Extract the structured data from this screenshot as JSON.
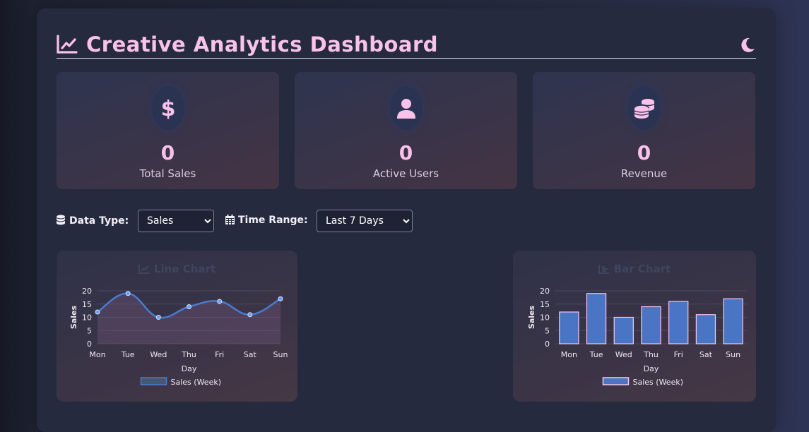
{
  "header": {
    "title": "Creative Analytics Dashboard",
    "title_icon": "chart-line-icon",
    "theme_toggle_icon": "moon-icon"
  },
  "stats": [
    {
      "icon": "dollar-icon",
      "value": "0",
      "label": "Total Sales"
    },
    {
      "icon": "user-icon",
      "value": "0",
      "label": "Active Users"
    },
    {
      "icon": "coins-icon",
      "value": "0",
      "label": "Revenue"
    }
  ],
  "controls": {
    "data_type_label": "Data Type:",
    "data_type_value": "Sales",
    "time_range_label": "Time Range:",
    "time_range_value": "Last 7 Days"
  },
  "colors": {
    "accent": "#f8c2ea",
    "series": "#4a7bd0",
    "panel": "#252a3f"
  },
  "chart_data": [
    {
      "type": "line",
      "title": "Line Chart",
      "categories": [
        "Mon",
        "Tue",
        "Wed",
        "Thu",
        "Fri",
        "Sat",
        "Sun"
      ],
      "series": [
        {
          "name": "Sales (Week)",
          "values": [
            12,
            19,
            10,
            14,
            16,
            11,
            17
          ]
        }
      ],
      "xlabel": "Day",
      "ylabel": "Sales",
      "ylim": [
        0,
        20
      ],
      "yticks": [
        "0",
        "5",
        "10",
        "15",
        "20"
      ],
      "legend": "bottom"
    },
    {
      "type": "bar",
      "title": "Bar Chart",
      "categories": [
        "Mon",
        "Tue",
        "Wed",
        "Thu",
        "Fri",
        "Sat",
        "Sun"
      ],
      "series": [
        {
          "name": "Sales (Week)",
          "values": [
            12,
            19,
            10,
            14,
            16,
            11,
            17
          ]
        }
      ],
      "xlabel": "Day",
      "ylabel": "Sales",
      "ylim": [
        0,
        20
      ],
      "yticks": [
        "0",
        "5",
        "10",
        "15",
        "20"
      ],
      "legend": "bottom"
    }
  ]
}
